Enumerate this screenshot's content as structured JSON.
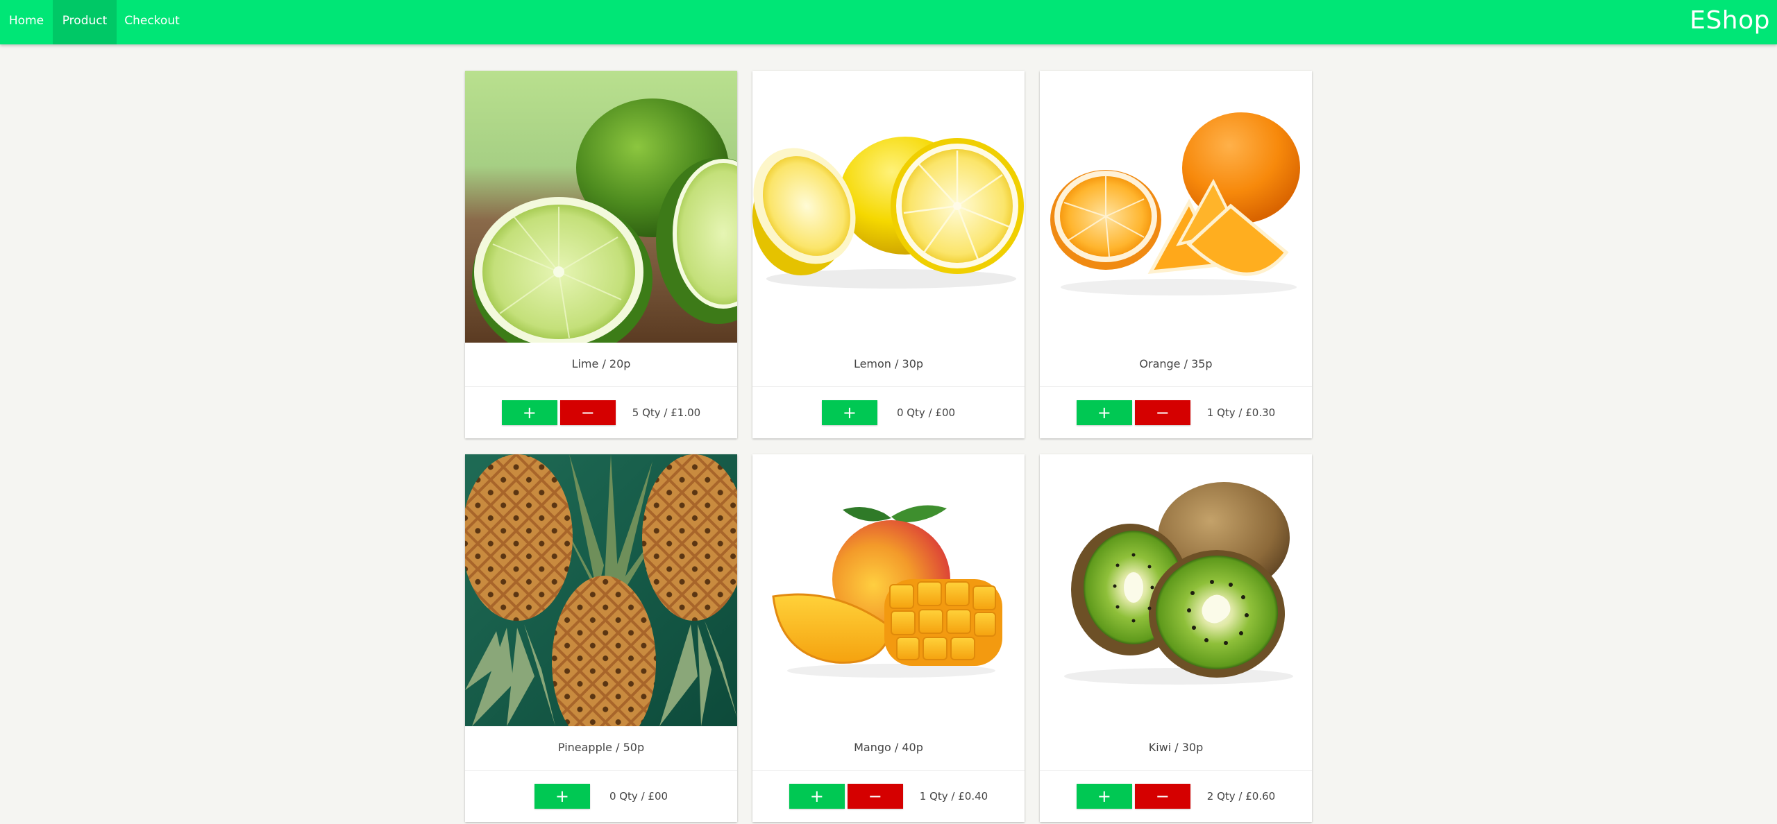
{
  "nav": {
    "items": [
      {
        "label": "Home",
        "active": false
      },
      {
        "label": "Product",
        "active": true
      },
      {
        "label": "Checkout",
        "active": false
      }
    ],
    "brand": "EShop",
    "colors": {
      "bar": "#00e676",
      "active": "#00c866"
    }
  },
  "buttons": {
    "add_label": "+",
    "remove_label": "−",
    "add_color": "#00c853",
    "remove_color": "#d50000"
  },
  "products": [
    {
      "title": "Lime / 20p",
      "qty": "5 Qty / £1.00",
      "image": "lime-image",
      "show_remove": true
    },
    {
      "title": "Lemon / 30p",
      "qty": "0 Qty / £00",
      "image": "lemon-image",
      "show_remove": false
    },
    {
      "title": "Orange / 35p",
      "qty": "1 Qty / £0.30",
      "image": "orange-image",
      "show_remove": true
    },
    {
      "title": "Pineapple / 50p",
      "qty": "0 Qty / £00",
      "image": "pineapple-image",
      "show_remove": false
    },
    {
      "title": "Mango / 40p",
      "qty": "1 Qty / £0.40",
      "image": "mango-image",
      "show_remove": true
    },
    {
      "title": "Kiwi / 30p",
      "qty": "2 Qty / £0.60",
      "image": "kiwi-image",
      "show_remove": true
    }
  ]
}
